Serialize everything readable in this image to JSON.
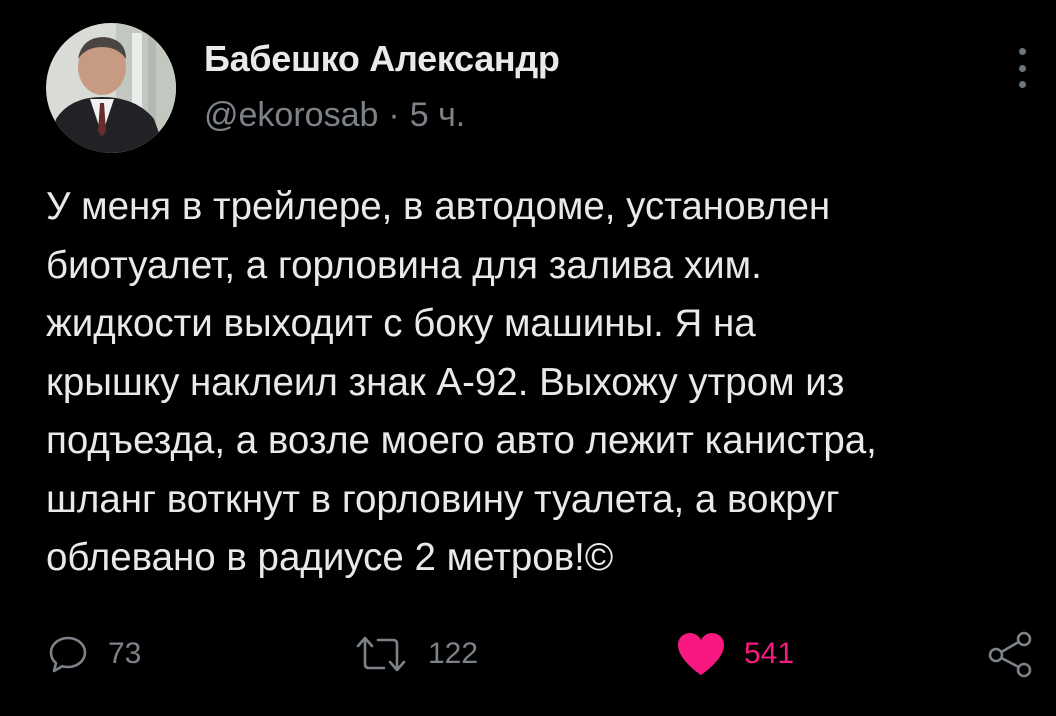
{
  "author": {
    "display_name": "Бабешко Александр",
    "handle": "@ekorosab",
    "separator": "·",
    "time": "5 ч."
  },
  "tweet": {
    "lines": [
      "У меня в трейлере, в автодоме, установлен",
      "биотуалет, а горловина для залива хим.",
      "жидкости выходит с боку машины. Я на",
      "крышку наклеил знак А-92. Выхожу утром из",
      "подъезда, а возле моего авто лежит канистра,",
      "шланг воткнут в горловину туалета, а вокруг",
      "облевано в радиусе 2 метров!©"
    ]
  },
  "actions": {
    "reply_count": "73",
    "retweet_count": "122",
    "like_count": "541"
  },
  "icons": {
    "avatar": "avatar",
    "more": "more-vertical-icon",
    "reply": "reply-icon",
    "retweet": "retweet-icon",
    "like": "heart-icon",
    "share": "share-icon"
  },
  "colors": {
    "background": "#000000",
    "text": "#e7e9ea",
    "muted": "#7c8288",
    "like": "#f91880"
  }
}
